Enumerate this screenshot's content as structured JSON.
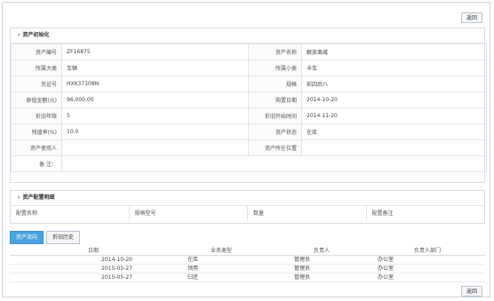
{
  "back_label": "返回",
  "section1": {
    "title": "资产初始化",
    "rows": [
      {
        "l1": "资产编号",
        "v1": "ZF16875",
        "l2": "资产名称",
        "v2": "解放离威"
      },
      {
        "l1": "所属大类",
        "v1": "车辆",
        "l2": "所属小类",
        "v2": "卡车"
      },
      {
        "l1": "凭证号",
        "v1": "HXK37108N",
        "l2": "规格",
        "v2": "前四后八"
      },
      {
        "l1": "原值金额(元)",
        "v1": "96,000.00",
        "l2": "购置日期",
        "v2": "2014-10-20"
      },
      {
        "l1": "折旧年限",
        "v1": "5",
        "l2": "折旧开始时间",
        "v2": "2014-11-20"
      },
      {
        "l1": "残值率(%)",
        "v1": "10.0",
        "l2": "资产状态",
        "v2": "在库"
      },
      {
        "l1": "资产使用人",
        "v1": "",
        "l2": "资产所在位置",
        "v2": ""
      }
    ],
    "remark_label": "备 注：",
    "remark_value": ""
  },
  "section2": {
    "title": "资产配置明细",
    "columns": [
      "配置名称",
      "规格型号",
      "数量",
      "配置备注"
    ]
  },
  "tabs": [
    {
      "label": "资产流向",
      "active": true
    },
    {
      "label": "折旧历史",
      "active": false
    }
  ],
  "flow": {
    "headers": [
      "日期",
      "业务类型",
      "负责人",
      "负责人部门"
    ],
    "rows": [
      {
        "date": "2014-10-20",
        "type": "在库",
        "person": "管理员",
        "dept": "办公室"
      },
      {
        "date": "2015-05-27",
        "type": "领用",
        "person": "管理员",
        "dept": "办公室"
      },
      {
        "date": "2015-05-27",
        "type": "归还",
        "person": "管理员",
        "dept": "办公室"
      }
    ]
  }
}
